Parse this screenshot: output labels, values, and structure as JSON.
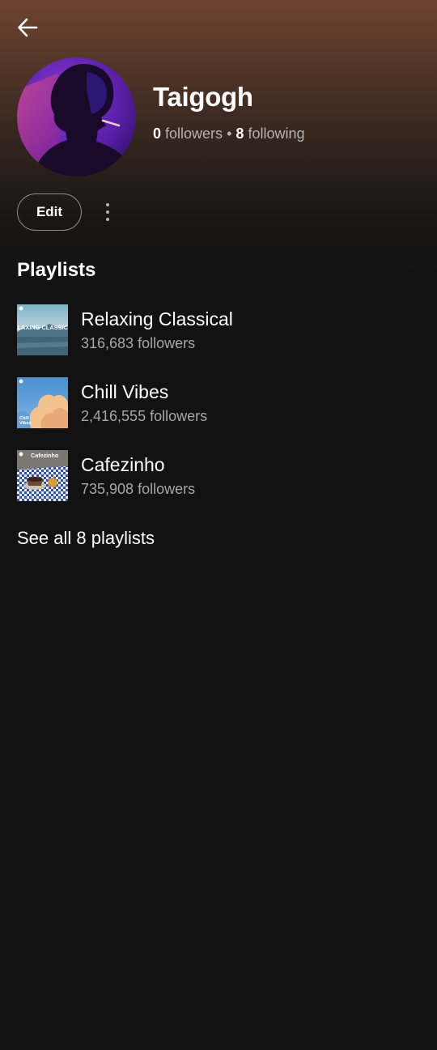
{
  "header": {
    "back_icon": "arrow-left-icon"
  },
  "profile": {
    "name": "Taigogh",
    "followers_count": "0",
    "followers_label": "followers",
    "separator": "•",
    "following_count": "8",
    "following_label": "following",
    "avatar_icon": "silhouette-portrait",
    "accent_color": "#6a2bd6"
  },
  "actions": {
    "edit_label": "Edit",
    "more_icon": "more-vertical-icon"
  },
  "playlists_section": {
    "title": "Playlists",
    "items": [
      {
        "title": "Relaxing Classical",
        "followers": "316,683 followers",
        "cover_text": "RELAXING CLASSICAL"
      },
      {
        "title": "Chill Vibes",
        "followers": "2,416,555 followers",
        "cover_text": "Chill Vibes"
      },
      {
        "title": "Cafezinho",
        "followers": "735,908 followers",
        "cover_text": "Cafezinho"
      }
    ],
    "see_all_label": "See all 8 playlists"
  },
  "colors": {
    "background": "#121212",
    "header_gradient_top": "#6e4430",
    "secondary_text": "#a7a7a7"
  }
}
